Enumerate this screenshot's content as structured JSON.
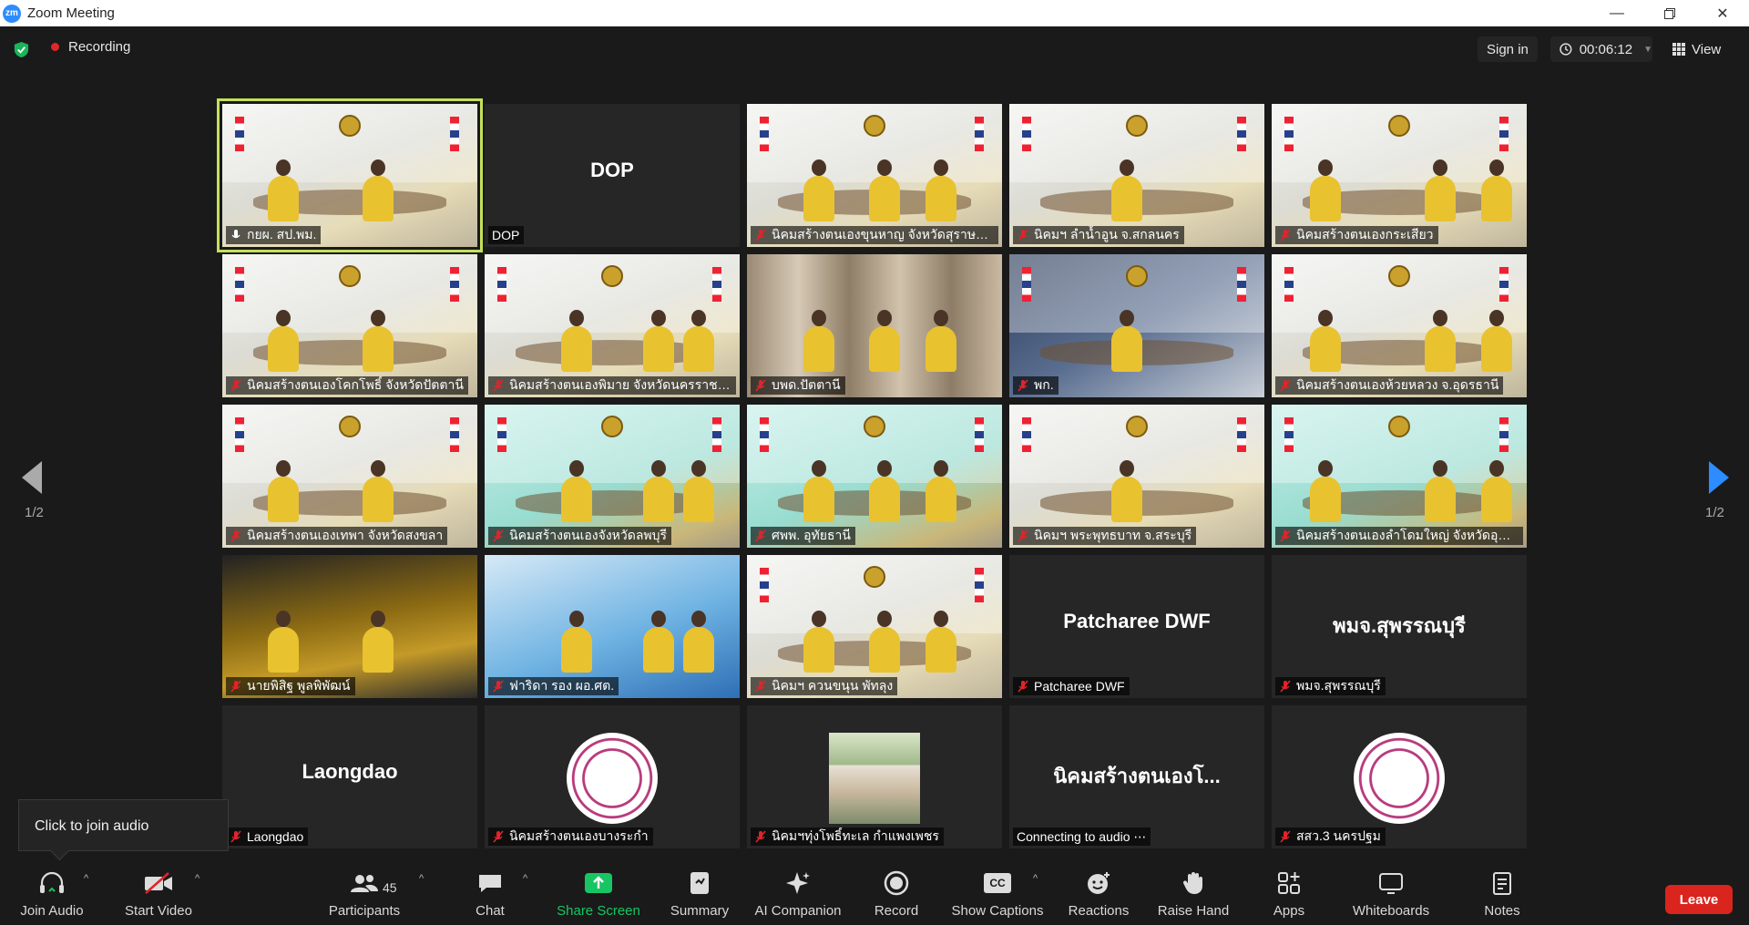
{
  "window": {
    "title": "Zoom Meeting",
    "logo_text": "zm"
  },
  "topbar": {
    "recording_label": "Recording",
    "signin_label": "Sign in",
    "timer": "00:06:12",
    "view_label": "View"
  },
  "gallery": {
    "page_indicator_left": "1/2",
    "page_indicator_right": "1/2",
    "tiles": [
      {
        "label": "กยผ. สป.พม.",
        "center_text": "",
        "kind": "video",
        "muted": false,
        "active": true
      },
      {
        "label": "DOP",
        "center_text": "DOP",
        "kind": "name",
        "muted": false,
        "active": false
      },
      {
        "label": "นิคมสร้างตนเองขุนหาญ จังหวัดสุราษฎร์...",
        "center_text": "",
        "kind": "video",
        "muted": true,
        "active": false
      },
      {
        "label": "นิคมฯ ลำน้ำอูน จ.สกลนคร",
        "center_text": "",
        "kind": "video",
        "muted": true,
        "active": false
      },
      {
        "label": "นิคมสร้างตนเองกระเสียว",
        "center_text": "",
        "kind": "video",
        "muted": true,
        "active": false
      },
      {
        "label": "นิคมสร้างตนเองโคกโพธิ์ จังหวัดปัตตานี",
        "center_text": "",
        "kind": "video",
        "muted": true,
        "active": false
      },
      {
        "label": "นิคมสร้างตนเองพิมาย จังหวัดนครราชสีมา",
        "center_text": "",
        "kind": "video",
        "muted": true,
        "active": false
      },
      {
        "label": "บพด.ปัตตานี",
        "center_text": "",
        "kind": "curtain",
        "muted": true,
        "active": false
      },
      {
        "label": "พก.",
        "center_text": "",
        "kind": "dark",
        "muted": true,
        "active": false
      },
      {
        "label": "นิคมสร้างตนเองห้วยหลวง จ.อุดรธานี",
        "center_text": "",
        "kind": "video",
        "muted": true,
        "active": false
      },
      {
        "label": "นิคมสร้างตนเองเทพา จังหวัดสงขลา",
        "center_text": "",
        "kind": "video",
        "muted": true,
        "active": false
      },
      {
        "label": "นิคมสร้างตนเองจังหวัดลพบุรี",
        "center_text": "",
        "kind": "green",
        "muted": true,
        "active": false
      },
      {
        "label": "ศพพ. อุทัยธานี",
        "center_text": "",
        "kind": "green",
        "muted": true,
        "active": false
      },
      {
        "label": "นิคมฯ พระพุทธบาท จ.สระบุรี",
        "center_text": "",
        "kind": "video",
        "muted": true,
        "active": false
      },
      {
        "label": "นิคมสร้างตนเองลำโดมใหญ่ จังหวัดอุบลร...",
        "center_text": "",
        "kind": "green",
        "muted": true,
        "active": false
      },
      {
        "label": "นายพิสิฐ พูลพิพัฒน์",
        "center_text": "",
        "kind": "gold",
        "muted": true,
        "active": false
      },
      {
        "label": "ฟาริดา รอง ผอ.ศต.",
        "center_text": "",
        "kind": "blue",
        "muted": true,
        "active": false
      },
      {
        "label": "นิคมฯ ควนขนุน พัทลุง",
        "center_text": "",
        "kind": "video",
        "muted": true,
        "active": false
      },
      {
        "label": "Patcharee DWF",
        "center_text": "Patcharee DWF",
        "kind": "name",
        "muted": true,
        "active": false
      },
      {
        "label": "พมจ.สุพรรณบุรี",
        "center_text": "พมจ.สุพรรณบุรี",
        "kind": "name",
        "muted": true,
        "active": false
      },
      {
        "label": "Laongdao",
        "center_text": "Laongdao",
        "kind": "name",
        "muted": true,
        "active": false
      },
      {
        "label": "นิคมสร้างตนเองบางระกำ",
        "center_text": "",
        "kind": "seal",
        "muted": true,
        "active": false
      },
      {
        "label": "นิคมฯทุ่งโพธิ์ทะเล กำแพงเพชร",
        "center_text": "",
        "kind": "photo",
        "muted": true,
        "active": false
      },
      {
        "label": "Connecting to audio ⋯",
        "center_text": "นิคมสร้างตนเองโ...",
        "kind": "name",
        "muted": false,
        "active": false
      },
      {
        "label": "สสว.3 นครปฐม",
        "center_text": "",
        "kind": "seal",
        "muted": true,
        "active": false
      }
    ]
  },
  "tooltip": {
    "text": "Click to join audio"
  },
  "toolbar": {
    "join_audio": "Join Audio",
    "start_video": "Start Video",
    "participants": "Participants",
    "participants_count": "45",
    "chat": "Chat",
    "share_screen": "Share Screen",
    "summary": "Summary",
    "ai_companion": "AI Companion",
    "record": "Record",
    "show_captions": "Show Captions",
    "captions_icon_text": "CC",
    "reactions": "Reactions",
    "raise_hand": "Raise Hand",
    "apps": "Apps",
    "whiteboards": "Whiteboards",
    "notes": "Notes",
    "leave": "Leave"
  },
  "colors": {
    "accent": "#2d8cff",
    "active_speaker": "#c4e05a",
    "leave": "#d9251d",
    "share": "#18c563",
    "mic_muted": "#e0242b"
  }
}
